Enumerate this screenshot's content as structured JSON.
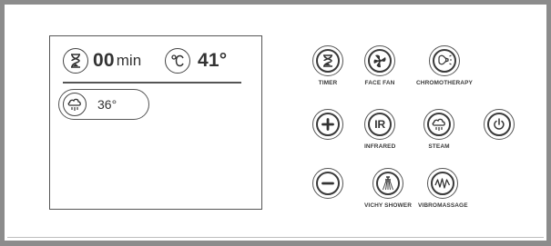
{
  "display": {
    "timer_value": "00",
    "timer_unit": "min",
    "temperature_value": "41°",
    "steam_temperature": "36°"
  },
  "buttons": {
    "timer": "TIMER",
    "face_fan": "FACE FAN",
    "chromotherapy": "CHROMOTHERAPY",
    "plus": "",
    "infrared": "INFRARED",
    "infrared_icon_text": "IR",
    "steam": "STEAM",
    "power": "",
    "minus": "",
    "vichy_shower": "VICHY SHOWER",
    "vibromassage": "VIBROMASSAGE"
  },
  "icons": {
    "timer": "hourglass-icon",
    "temperature": "celsius-icon",
    "steam": "steam-cloud-icon",
    "face_fan": "fan-icon",
    "chromotherapy": "light-bulb-icon",
    "plus": "plus-icon",
    "infrared": "ir-icon",
    "power": "power-icon",
    "minus": "minus-icon",
    "vichy_shower": "shower-icon",
    "vibromassage": "wave-icon"
  },
  "colors": {
    "frame": "#8c8c8c",
    "line": "#3a3a3a",
    "background": "#ffffff"
  }
}
